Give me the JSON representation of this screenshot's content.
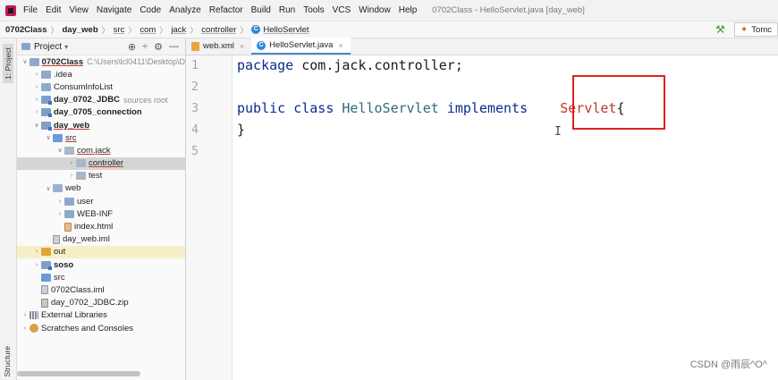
{
  "menubar": {
    "items": [
      "File",
      "Edit",
      "View",
      "Navigate",
      "Code",
      "Analyze",
      "Refactor",
      "Build",
      "Run",
      "Tools",
      "VCS",
      "Window",
      "Help"
    ],
    "title": "0702Class - HelloServlet.java [day_web]"
  },
  "navbar": {
    "crumbs": [
      "0702Class",
      "day_web",
      "src",
      "com",
      "jack",
      "controller",
      "HelloServlet"
    ],
    "run_config": "Tomc",
    "class_icon": "C"
  },
  "toolstrip": {
    "project_tab": "1: Project",
    "structure_tab": "Structure"
  },
  "project": {
    "title": "Project",
    "tools": [
      "⊕",
      "÷",
      "⚙",
      "—"
    ],
    "tree": [
      {
        "label": "0702Class",
        "extra": "C:\\Users\\lcl0411\\Desktop\\D",
        "arrow": "v",
        "icon": "folder",
        "bold": true,
        "underline": true
      },
      {
        "label": ".idea",
        "arrow": ">",
        "icon": "folder"
      },
      {
        "label": "ConsumInfoList",
        "arrow": ">",
        "icon": "folder"
      },
      {
        "label": "day_0702_JDBC",
        "extra": "sources root",
        "arrow": ">",
        "icon": "folder-mod",
        "bold": true
      },
      {
        "label": "day_0705_connection",
        "arrow": ">",
        "icon": "folder-mod",
        "bold": true
      },
      {
        "label": "day_web",
        "arrow": "v",
        "icon": "folder-mod",
        "bold": true,
        "underline": true
      },
      {
        "label": "src",
        "arrow": "v",
        "icon": "folder-src",
        "underline": true
      },
      {
        "label": "com.jack",
        "arrow": "v",
        "icon": "folder-pkg",
        "underline": true
      },
      {
        "label": "controller",
        "arrow": ">",
        "icon": "folder-pkg",
        "underline": true,
        "selected": true
      },
      {
        "label": "test",
        "arrow": ">",
        "icon": "folder-pkg"
      },
      {
        "label": "web",
        "arrow": "v",
        "icon": "folder-web"
      },
      {
        "label": "user",
        "arrow": ">",
        "icon": "folder"
      },
      {
        "label": "WEB-INF",
        "arrow": ">",
        "icon": "folder"
      },
      {
        "label": "index.html",
        "arrow": "",
        "icon": "file-html"
      },
      {
        "label": "day_web.iml",
        "arrow": "",
        "icon": "file-iml"
      },
      {
        "label": "out",
        "arrow": ">",
        "icon": "folder-out",
        "highlight": true
      },
      {
        "label": "soso",
        "arrow": ">",
        "icon": "folder-mod",
        "bold": true
      },
      {
        "label": "src",
        "arrow": "",
        "icon": "folder-src"
      },
      {
        "label": "0702Class.iml",
        "arrow": "",
        "icon": "file-iml"
      },
      {
        "label": "day_0702_JDBC.zip",
        "arrow": "",
        "icon": "file-zip"
      },
      {
        "label": "External Libraries",
        "arrow": ">",
        "icon": "libs"
      },
      {
        "label": "Scratches and Consoles",
        "arrow": ">",
        "icon": "scratch"
      }
    ]
  },
  "editor": {
    "tabs": [
      {
        "label": "web.xml",
        "active": false,
        "icon": "xml"
      },
      {
        "label": "HelloServlet.java",
        "active": true,
        "icon": "class"
      }
    ],
    "line_numbers": [
      "1",
      "2",
      "3",
      "4",
      "5"
    ],
    "code": {
      "line1_kw": "package",
      "line1_rest": " com.jack.controller;",
      "line3_kw1": "public",
      "line3_kw2": "class",
      "line3_cls": "HelloServlet",
      "line3_kw3": "implements",
      "line3_err": "Servlet",
      "line3_brace": "{",
      "line4": "}"
    },
    "cursor_glyph": "I"
  },
  "watermark": "CSDN @雨辰^O^"
}
